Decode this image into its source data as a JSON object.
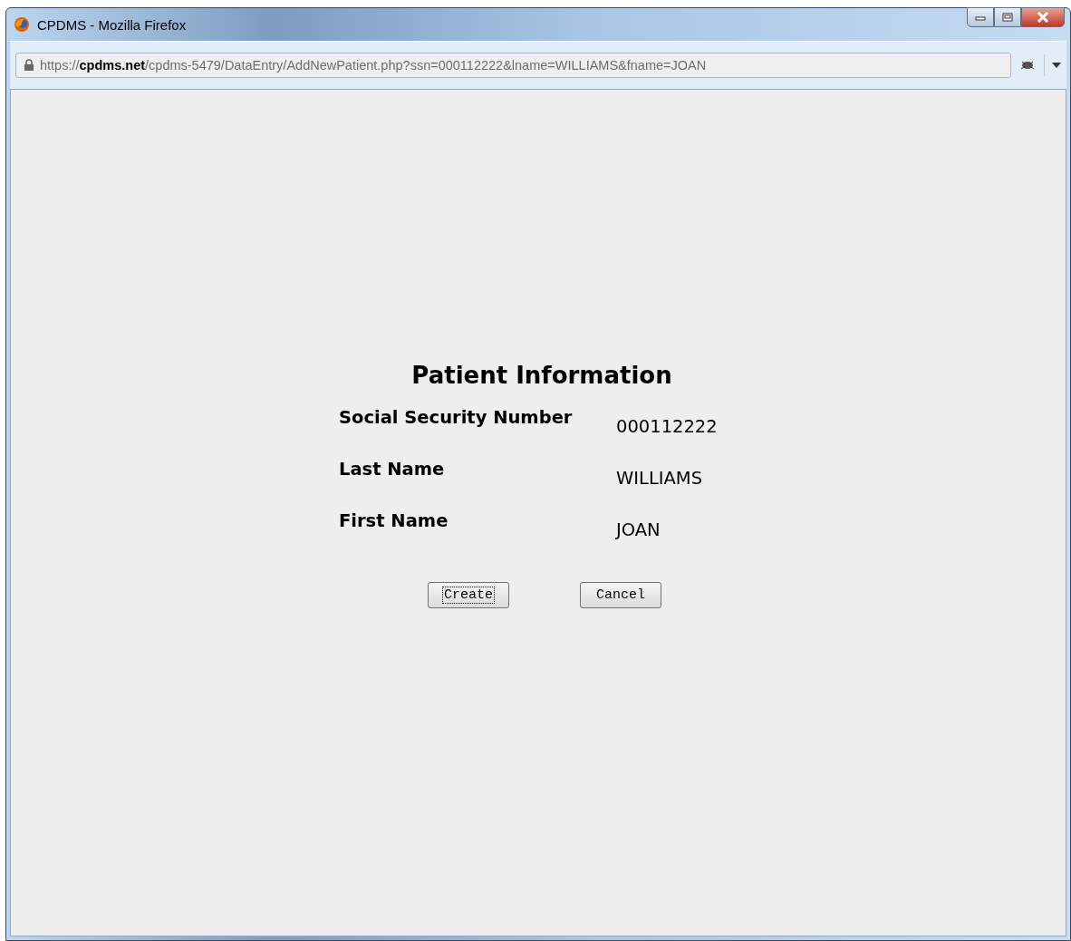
{
  "window": {
    "title": "CPDMS - Mozilla Firefox"
  },
  "address_bar": {
    "url": "https://**cpdms.net**/cpdms-5479/DataEntry/AddNewPatient.php?ssn=000112222&lname=WILLIAMS&fname=JOAN"
  },
  "form": {
    "title": "Patient Information",
    "fields": [
      {
        "label": "Social Security Number",
        "value": "000112222"
      },
      {
        "label": "Last Name",
        "value": "WILLIAMS"
      },
      {
        "label": "First Name",
        "value": "JOAN"
      }
    ],
    "buttons": [
      {
        "label": "Create",
        "focused": true
      },
      {
        "label": "Cancel",
        "focused": false
      }
    ]
  }
}
